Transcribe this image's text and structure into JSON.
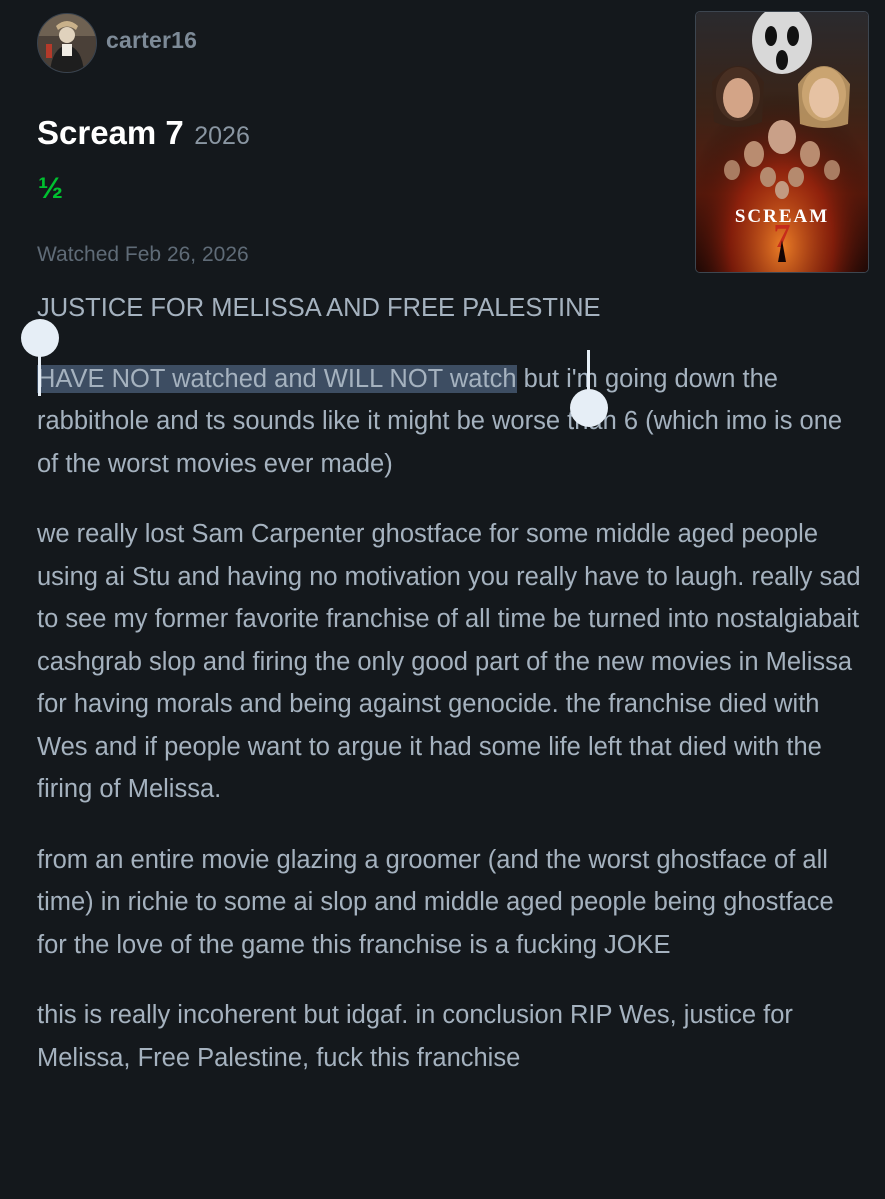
{
  "user": {
    "username": "carter16",
    "avatar_icon": "user-avatar-photo"
  },
  "film": {
    "title": "Scream 7",
    "year": "2026",
    "rating": "½",
    "watched": "Watched Feb 26, 2026",
    "poster": {
      "wordmark": "SCREAM",
      "numeral": "7"
    }
  },
  "review": {
    "p1": "JUSTICE FOR MELISSA AND FREE PALESTINE",
    "p2_selected": "HAVE NOT watched and WILL NOT watch",
    "p2_rest": " but i'm going down the rabbithole and ts sounds like it might be worse than 6 (which imo is one of the worst movies ever made)",
    "p3": "we really lost Sam Carpenter ghostface for some middle aged people using ai Stu and having no motivation you really have to laugh. really sad to see my former favorite franchise of all time be turned into nostalgiabait cashgrab slop and firing the only good part of the new movies in Melissa for having morals and being against genocide. the franchise died with Wes and if people want to argue it had some life left that died with the firing of Melissa.",
    "p4": "from an entire movie glazing a groomer (and the worst ghostface of all time) in richie to some ai slop and middle aged people being ghostface for the love of the game this franchise is a fucking JOKE",
    "p5": "this is really incoherent but idgaf. in conclusion RIP Wes, justice for Melissa, Free Palestine, fuck this franchise"
  },
  "colors": {
    "background": "#14181c",
    "rating_green": "#00c030",
    "selection_highlight": "#3d4d62"
  }
}
